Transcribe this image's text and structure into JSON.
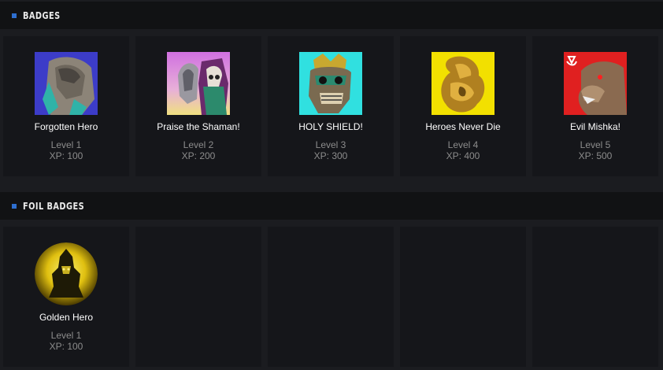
{
  "badges_section": {
    "title": "BADGES",
    "items": [
      {
        "name": "Forgotten Hero",
        "level": "Level 1",
        "xp": "XP: 100",
        "icon": "forgotten-hero-icon"
      },
      {
        "name": "Praise the Shaman!",
        "level": "Level 2",
        "xp": "XP: 200",
        "icon": "shaman-icon"
      },
      {
        "name": "HOLY SHIELD!",
        "level": "Level 3",
        "xp": "XP: 300",
        "icon": "holy-shield-icon"
      },
      {
        "name": "Heroes Never Die",
        "level": "Level 4",
        "xp": "XP: 400",
        "icon": "heroes-never-die-icon"
      },
      {
        "name": "Evil Mishka!",
        "level": "Level 5",
        "xp": "XP: 500",
        "icon": "evil-mishka-icon"
      }
    ]
  },
  "foil_section": {
    "title": "FOIL BADGES",
    "items": [
      {
        "name": "Golden Hero",
        "level": "Level 1",
        "xp": "XP: 100",
        "icon": "golden-hero-icon"
      }
    ]
  },
  "colors": {
    "background": "#1b1c20",
    "header_bg": "#111214",
    "card_bg": "#15161a",
    "accent": "#2e6fd0"
  }
}
